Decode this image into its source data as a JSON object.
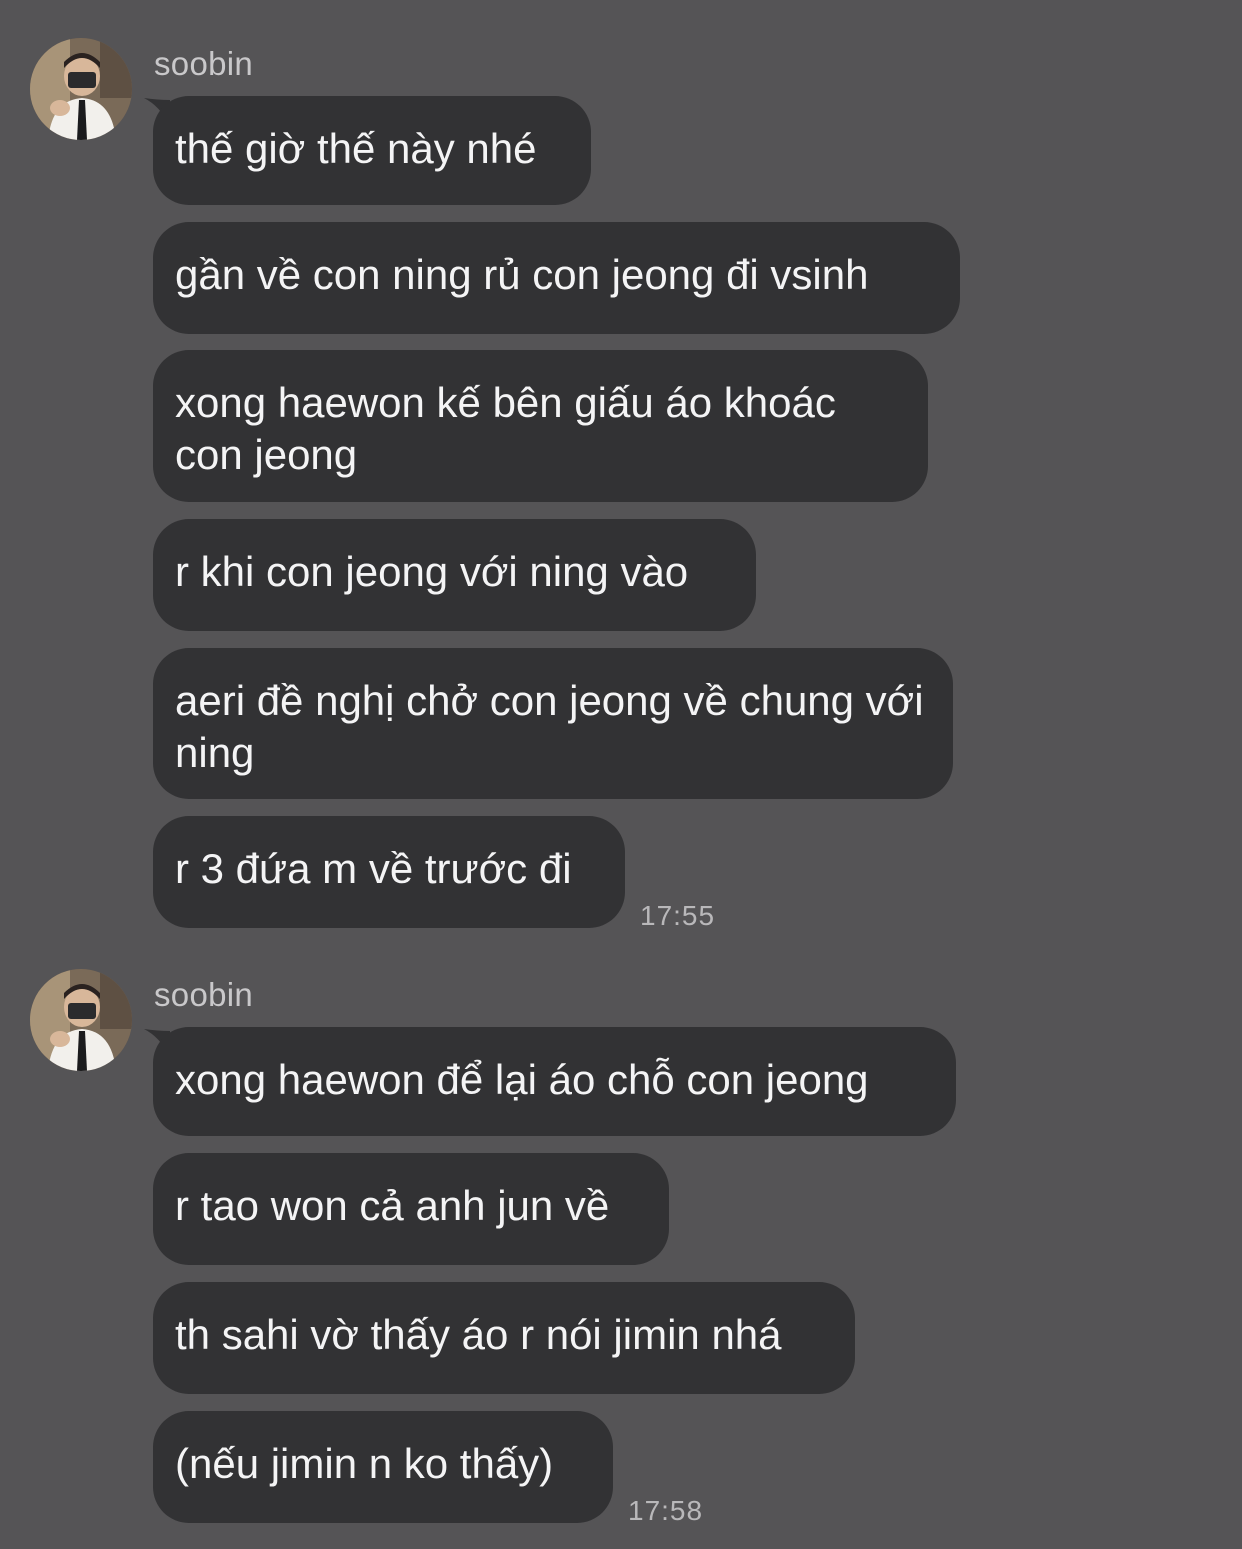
{
  "conversation": {
    "groups": [
      {
        "sender": "soobin",
        "time": "17:55",
        "messages": [
          "thế giờ thế này nhé",
          "gần về con ning rủ con jeong đi vsinh",
          "xong haewon kế bên giấu áo khoác con jeong",
          "r khi con jeong với ning vào",
          "aeri đề nghị chở con jeong về chung với ning",
          "r 3 đứa m về trước đi"
        ]
      },
      {
        "sender": "soobin",
        "time": "17:58",
        "messages": [
          "xong haewon để lại áo chỗ con jeong",
          "r tao won cả anh jun về",
          "th sahi vờ thấy áo r nói jimin nhá",
          "(nếu jimin n ko thấy)"
        ]
      }
    ]
  },
  "colors": {
    "background": "#555456",
    "bubble": "#323234",
    "text": "#f4f4f5",
    "meta": "#c9c8ca"
  }
}
